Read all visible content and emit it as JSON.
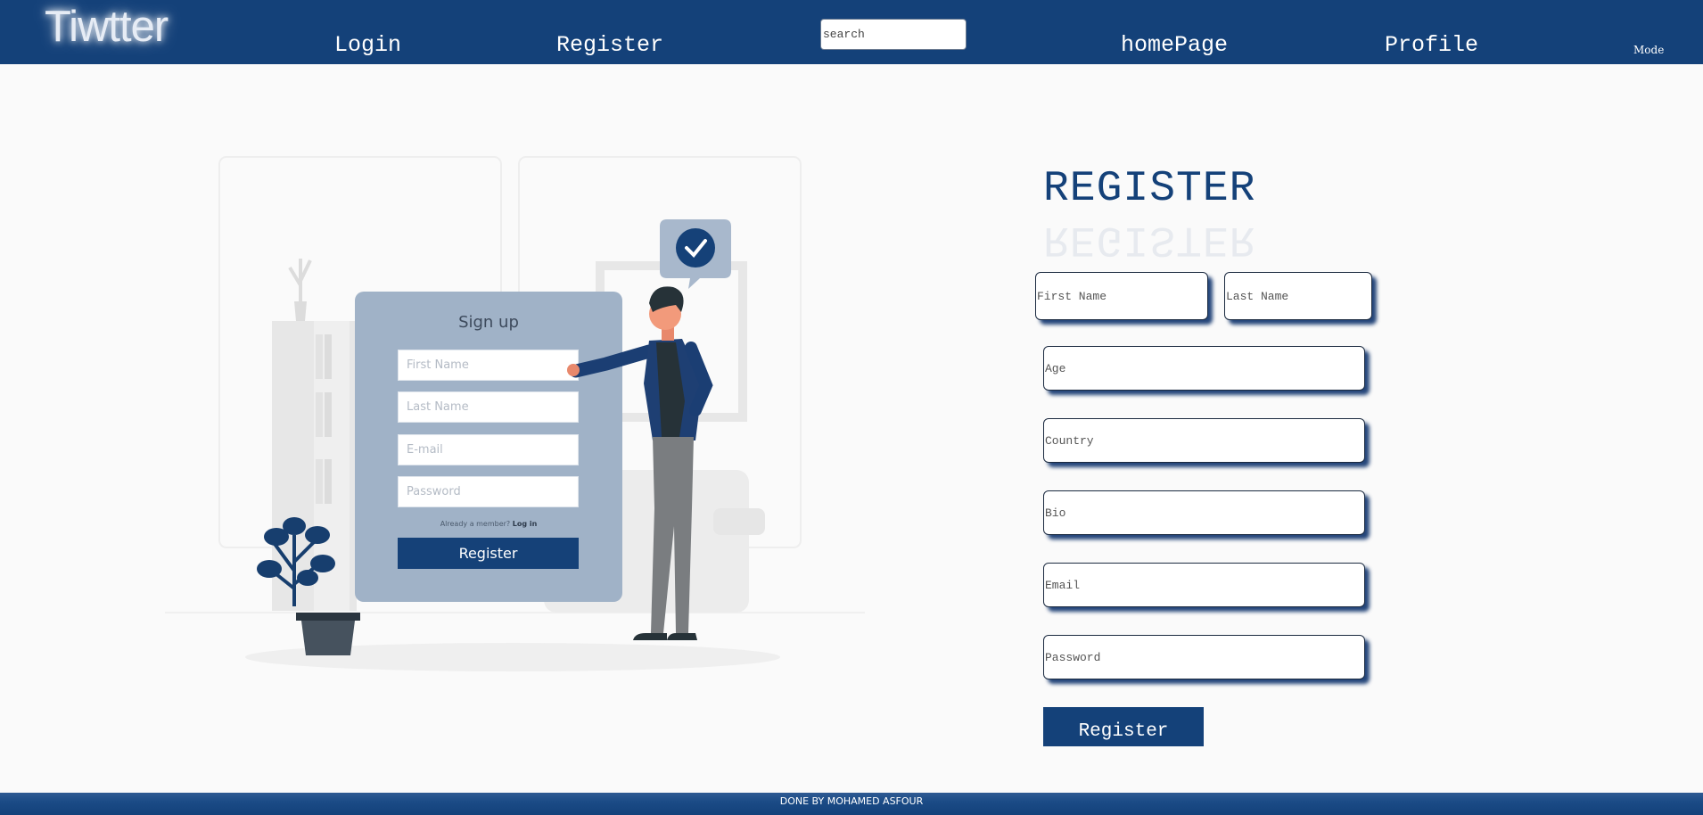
{
  "nav": {
    "brand": "Tiwtter",
    "links": [
      "Login",
      "Register",
      "homePage",
      "Profile"
    ],
    "search_placeholder": "search",
    "mode_label": "Mode"
  },
  "illustration": {
    "title": "Sign up",
    "fields": [
      "First Name",
      "Last Name",
      "E-mail",
      "Password"
    ],
    "member_text": "Already a member?",
    "member_link": "Log in",
    "button": "Register"
  },
  "form": {
    "title": "REGISTER",
    "first_name_placeholder": "First Name",
    "last_name_placeholder": "Last Name",
    "age_placeholder": "Age",
    "country_placeholder": "Country",
    "bio_placeholder": "Bio",
    "email_placeholder": "Email",
    "password_placeholder": "Password",
    "submit_label": "Register"
  },
  "footer": {
    "text": "DONE BY MOHAMED ASFOUR"
  },
  "colors": {
    "navbar": "#144179",
    "accent": "#144179",
    "background": "#fafafa"
  }
}
